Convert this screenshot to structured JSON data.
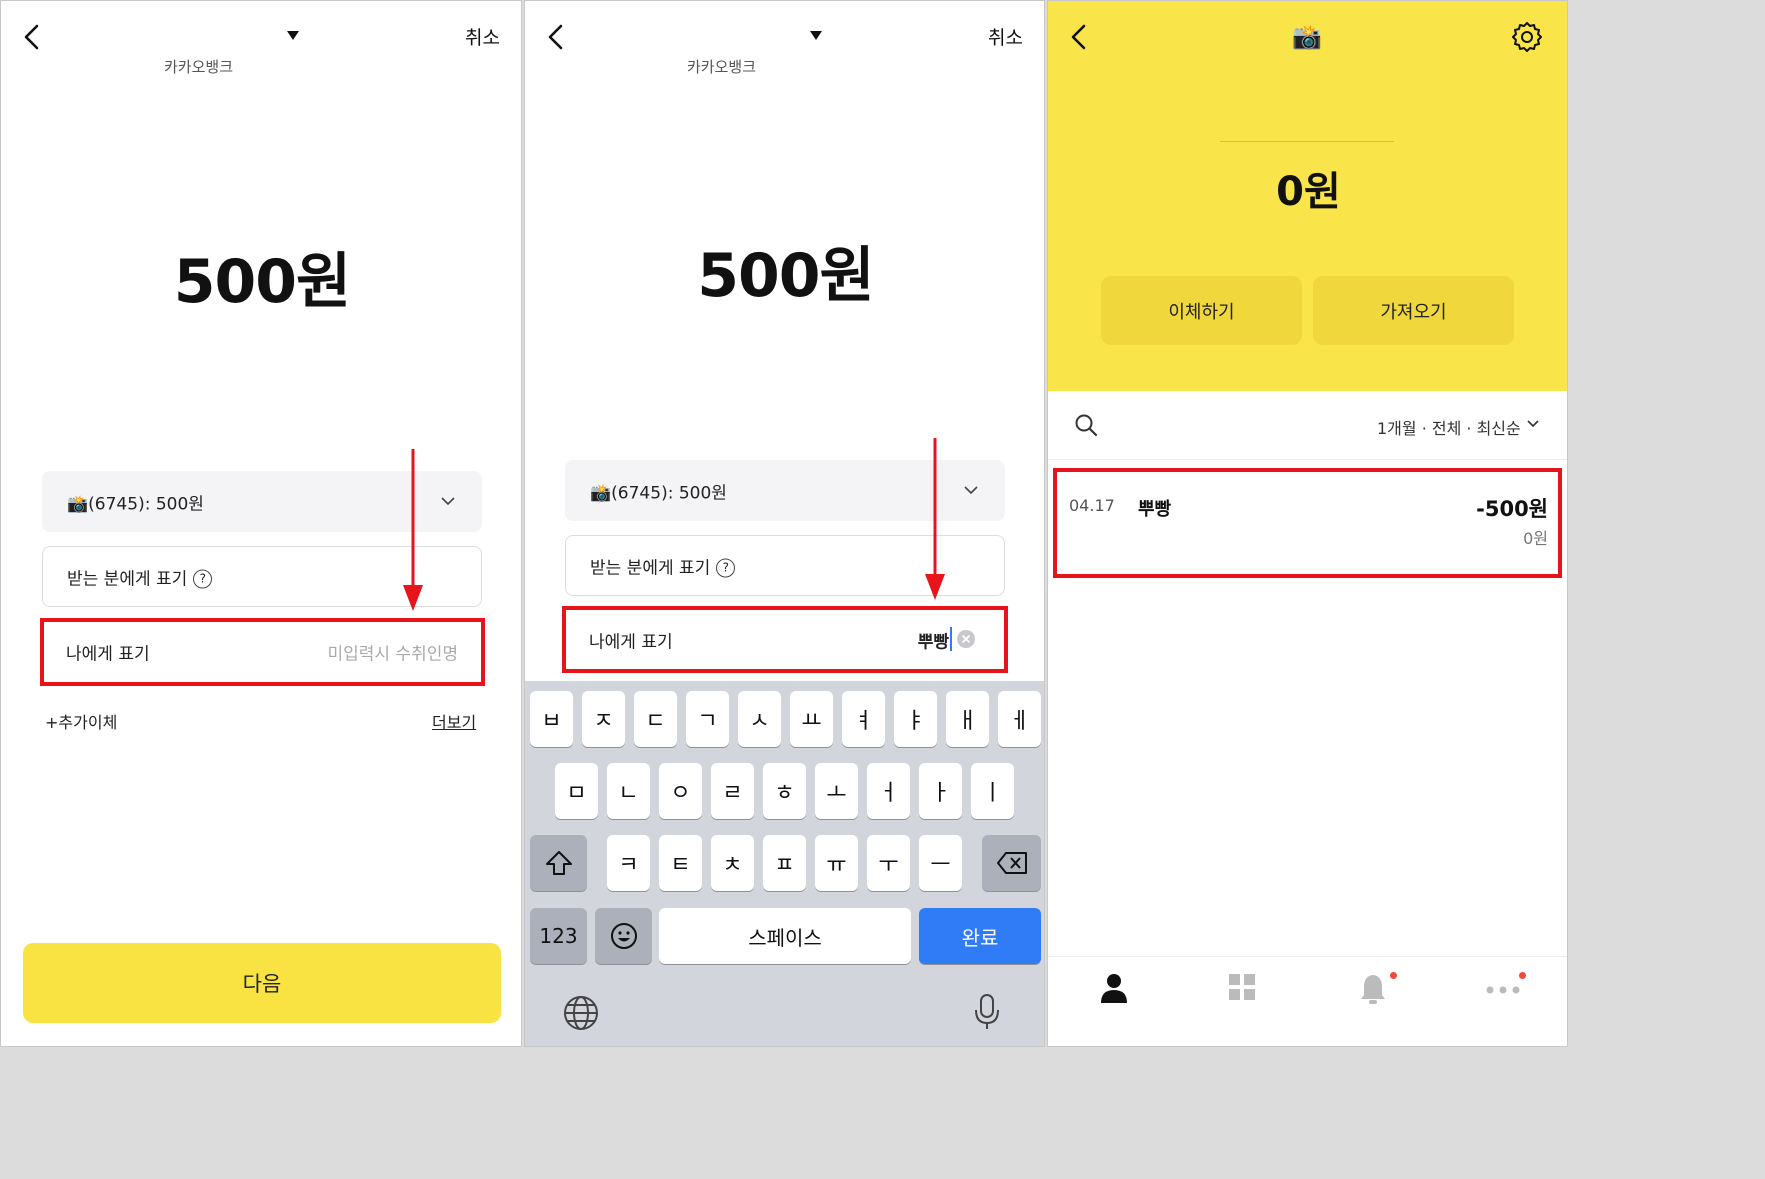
{
  "panel1": {
    "cancel_label": "취소",
    "bank_name": "카카오뱅크",
    "amount": "500원",
    "account_select": "📸(6745): 500원",
    "recipient_display_label": "받는 분에게 표기",
    "recipient_help": "?",
    "my_display_label": "나에게 표기",
    "my_display_placeholder": "미입력시 수취인명",
    "add_transfer_label": "+추가이체",
    "more_label": "더보기",
    "next_label": "다음"
  },
  "panel2": {
    "cancel_label": "취소",
    "bank_name": "카카오뱅크",
    "amount": "500원",
    "account_select": "📸(6745): 500원",
    "recipient_display_label": "받는 분에게 표기",
    "recipient_help": "?",
    "my_display_label": "나에게 표기",
    "my_display_value": "뿌빵",
    "keyboard": {
      "row1": [
        "ㅂ",
        "ㅈ",
        "ㄷ",
        "ㄱ",
        "ㅅ",
        "ㅛ",
        "ㅕ",
        "ㅑ",
        "ㅐ",
        "ㅔ"
      ],
      "row2": [
        "ㅁ",
        "ㄴ",
        "ㅇ",
        "ㄹ",
        "ㅎ",
        "ㅗ",
        "ㅓ",
        "ㅏ",
        "ㅣ"
      ],
      "row3": [
        "ㅋ",
        "ㅌ",
        "ㅊ",
        "ㅍ",
        "ㅠ",
        "ㅜ",
        "ㅡ"
      ],
      "numbers_label": "123",
      "space_label": "스페이스",
      "done_label": "완료"
    }
  },
  "panel3": {
    "title_icon": "📸",
    "balance": "0원",
    "transfer_label": "이체하기",
    "fetch_label": "가져오기",
    "filter_label": "1개월 · 전체 · 최신순",
    "transaction": {
      "date": "04.17",
      "name": "뿌빵",
      "amount": "-500원",
      "balance_after": "0원"
    }
  },
  "colors": {
    "accent_yellow": "#f9e343",
    "highlight_red": "#e8141b",
    "keyboard_blue": "#2f7cf6"
  }
}
